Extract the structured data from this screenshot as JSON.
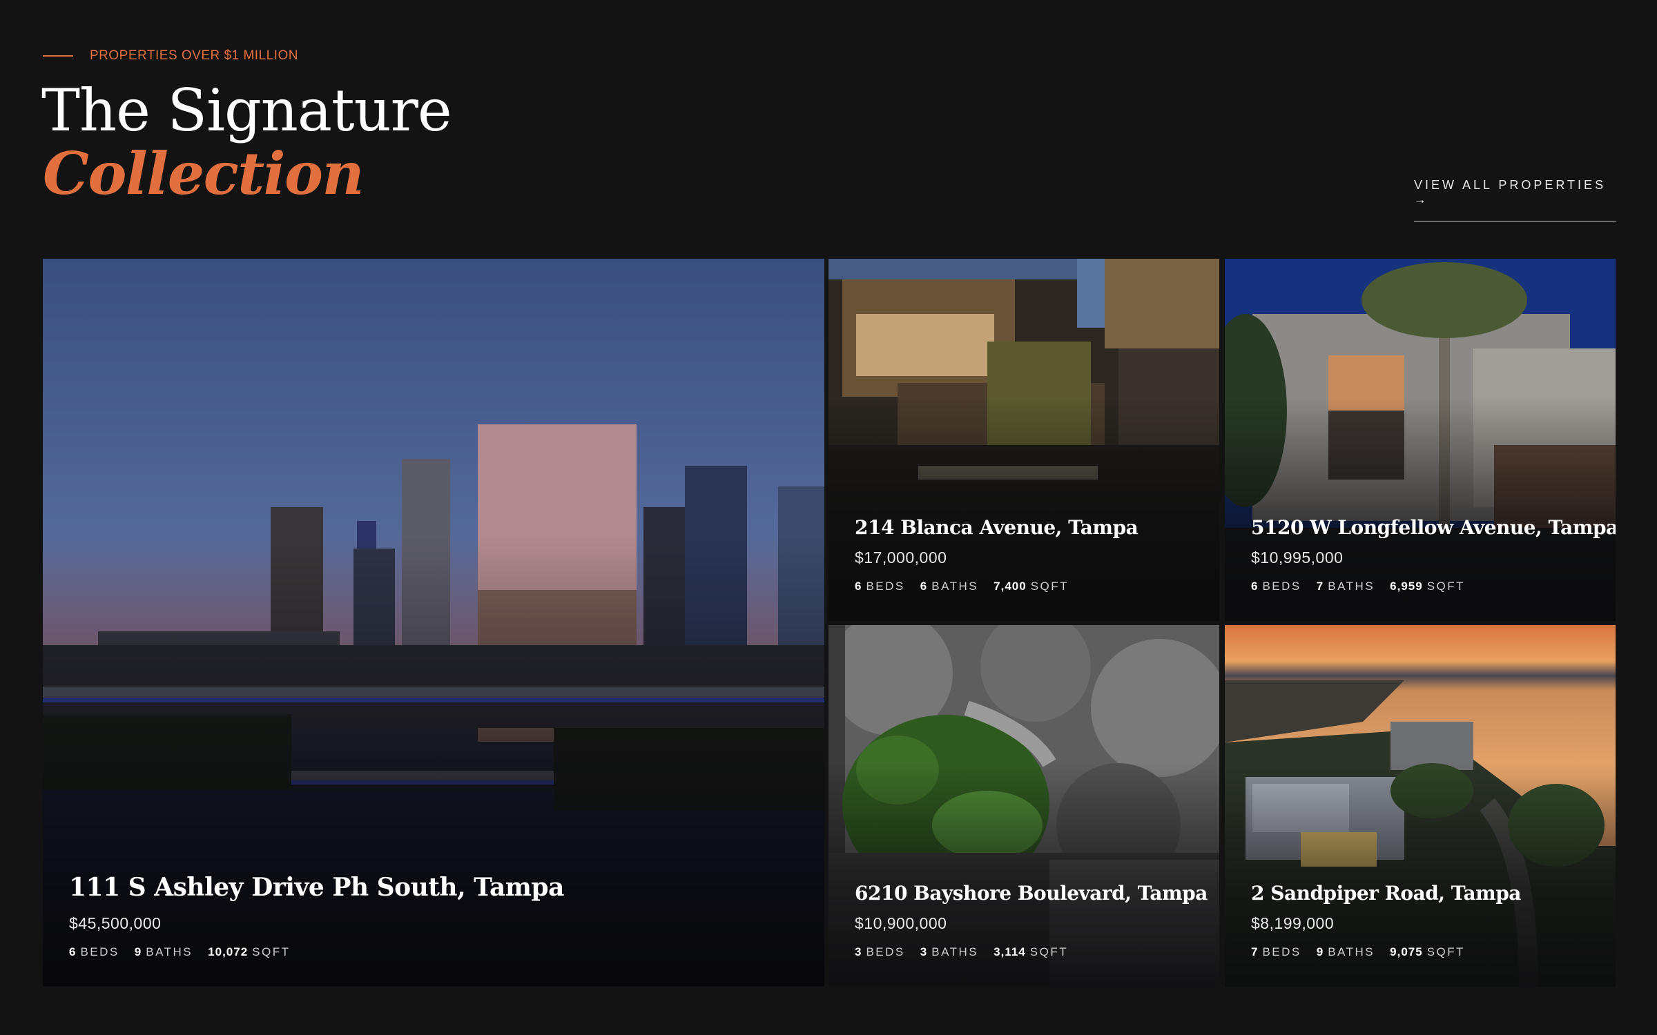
{
  "header": {
    "eyebrow": "PROPERTIES OVER $1 MILLION",
    "title_line1": "The Signature",
    "title_line2": "Collection",
    "view_all": "VIEW ALL PROPERTIES →"
  },
  "colors": {
    "background": "#131313",
    "accent": "#e2703f",
    "text": "#ffffff"
  },
  "listings": [
    {
      "address": "111 S Ashley Drive Ph South, Tampa",
      "price": "$45,500,000",
      "beds": "6",
      "beds_label": "BEDS",
      "baths": "9",
      "baths_label": "BATHS",
      "sqft": "10,072",
      "sqft_label": "SQFT"
    },
    {
      "address": "214 Blanca Avenue, Tampa",
      "price": "$17,000,000",
      "beds": "6",
      "beds_label": "BEDS",
      "baths": "6",
      "baths_label": "BATHS",
      "sqft": "7,400",
      "sqft_label": "SQFT"
    },
    {
      "address": "5120 W Longfellow Avenue, Tampa",
      "price": "$10,995,000",
      "beds": "6",
      "beds_label": "BEDS",
      "baths": "7",
      "baths_label": "BATHS",
      "sqft": "6,959",
      "sqft_label": "SQFT"
    },
    {
      "address": "6210 Bayshore Boulevard, Tampa",
      "price": "$10,900,000",
      "beds": "3",
      "beds_label": "BEDS",
      "baths": "3",
      "baths_label": "BATHS",
      "sqft": "3,114",
      "sqft_label": "SQFT"
    },
    {
      "address": "2 Sandpiper Road, Tampa",
      "price": "$8,199,000",
      "beds": "7",
      "beds_label": "BEDS",
      "baths": "9",
      "baths_label": "BATHS",
      "sqft": "9,075",
      "sqft_label": "SQFT"
    }
  ]
}
